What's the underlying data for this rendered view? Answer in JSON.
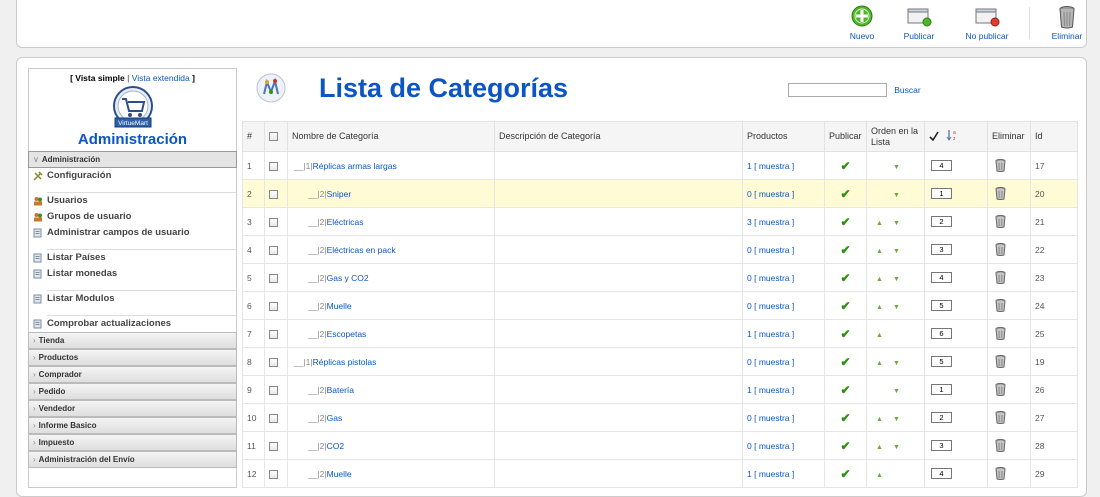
{
  "toolbar": {
    "buttons": [
      {
        "label": "Nuevo",
        "icon": "new-icon"
      },
      {
        "label": "Publicar",
        "icon": "publish-icon"
      },
      {
        "label": "No publicar",
        "icon": "unpublish-icon"
      },
      {
        "label": "Eliminar",
        "icon": "trash-icon"
      }
    ]
  },
  "sidebar": {
    "view_simple": "Vista simple",
    "view_separator": "|",
    "view_extended": "Vista extendida",
    "bracket_open": "[",
    "bracket_close": "]",
    "logo_text": "VirtueMart",
    "title": "Administración",
    "sections": [
      {
        "label": "Administración",
        "open": true
      },
      {
        "label": "Tienda"
      },
      {
        "label": "Productos"
      },
      {
        "label": "Comprador"
      },
      {
        "label": "Pedido"
      },
      {
        "label": "Vendedor"
      },
      {
        "label": "Informe Basico"
      },
      {
        "label": "Impuesto"
      },
      {
        "label": "Administración del Envío"
      }
    ],
    "items": [
      {
        "label": "Configuración",
        "icon": "config-icon"
      },
      {
        "label": "Usuarios",
        "icon": "users-icon"
      },
      {
        "label": "Grupos de usuario",
        "icon": "users-icon"
      },
      {
        "label": "Administrar campos de usuario",
        "icon": "list-icon"
      },
      {
        "label": "Listar Países",
        "icon": "list-icon"
      },
      {
        "label": "Listar monedas",
        "icon": "list-icon"
      },
      {
        "label": "Listar Modulos",
        "icon": "list-icon"
      },
      {
        "label": "Comprobar actualizaciones",
        "icon": "list-icon"
      }
    ]
  },
  "page": {
    "title": "Lista de Categorías",
    "search_button": "Buscar",
    "search_value": ""
  },
  "table": {
    "headers": {
      "num": "#",
      "name": "Nombre de Categoría",
      "desc": "Descripción de Categoría",
      "products": "Productos",
      "publish": "Publicar",
      "order": "Orden en la Lista",
      "delete": "Eliminar",
      "id": "Id"
    },
    "show_label": "[ muestra ]",
    "rows": [
      {
        "num": "1",
        "prefix": "__|1|",
        "name": "Réplicas armas largas",
        "level": 1,
        "products": "1",
        "order": "4",
        "id": "17",
        "up": false,
        "down": true
      },
      {
        "num": "2",
        "prefix": "__|2|",
        "name": "Sniper",
        "level": 2,
        "products": "0",
        "order": "1",
        "id": "20",
        "up": false,
        "down": true,
        "highlight": true
      },
      {
        "num": "3",
        "prefix": "__|2|",
        "name": "Eléctricas",
        "level": 2,
        "products": "3",
        "order": "2",
        "id": "21",
        "up": true,
        "down": true
      },
      {
        "num": "4",
        "prefix": "__|2|",
        "name": "Eléctricas en pack",
        "level": 2,
        "products": "0",
        "order": "3",
        "id": "22",
        "up": true,
        "down": true
      },
      {
        "num": "5",
        "prefix": "__|2|",
        "name": "Gas y CO2",
        "level": 2,
        "products": "0",
        "order": "4",
        "id": "23",
        "up": true,
        "down": true
      },
      {
        "num": "6",
        "prefix": "__|2|",
        "name": "Muelle",
        "level": 2,
        "products": "0",
        "order": "5",
        "id": "24",
        "up": true,
        "down": true
      },
      {
        "num": "7",
        "prefix": "__|2|",
        "name": "Escopetas",
        "level": 2,
        "products": "1",
        "order": "6",
        "id": "25",
        "up": true,
        "down": false
      },
      {
        "num": "8",
        "prefix": "__|1|",
        "name": "Réplicas pistolas",
        "level": 1,
        "products": "0",
        "order": "5",
        "id": "19",
        "up": true,
        "down": true
      },
      {
        "num": "9",
        "prefix": "__|2|",
        "name": "Batería",
        "level": 2,
        "products": "1",
        "order": "1",
        "id": "26",
        "up": false,
        "down": true
      },
      {
        "num": "10",
        "prefix": "__|2|",
        "name": "Gas",
        "level": 2,
        "products": "0",
        "order": "2",
        "id": "27",
        "up": true,
        "down": true
      },
      {
        "num": "11",
        "prefix": "__|2|",
        "name": "CO2",
        "level": 2,
        "products": "0",
        "order": "3",
        "id": "28",
        "up": true,
        "down": true
      },
      {
        "num": "12",
        "prefix": "__|2|",
        "name": "Muelle",
        "level": 2,
        "products": "1",
        "order": "4",
        "id": "29",
        "up": true,
        "down": false
      }
    ]
  },
  "colors": {
    "link": "#0b55c4",
    "highlight_row": "#fffbd5",
    "check": "#2f8f0e",
    "arrow": "#6aaa36"
  }
}
